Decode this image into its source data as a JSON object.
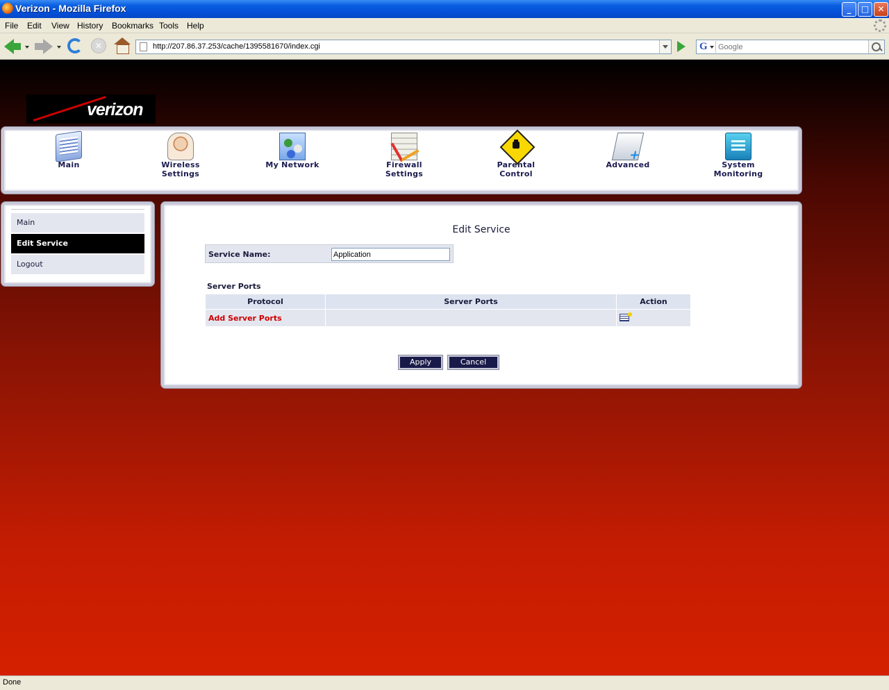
{
  "window": {
    "title": "Verizon - Mozilla Firefox"
  },
  "menu": [
    "File",
    "Edit",
    "View",
    "History",
    "Bookmarks",
    "Tools",
    "Help"
  ],
  "browser": {
    "url": "http://207.86.37.253/cache/1395581670/index.cgi",
    "search_placeholder": "Google",
    "search_engine_icon": "G"
  },
  "logo": {
    "text": "verizon"
  },
  "topnav": [
    {
      "label": "Main",
      "icon": "main-icon"
    },
    {
      "label": "Wireless\nSettings",
      "icon": "wireless-icon"
    },
    {
      "label": "My Network",
      "icon": "network-icon"
    },
    {
      "label": "Firewall\nSettings",
      "icon": "firewall-icon"
    },
    {
      "label": "Parental\nControl",
      "icon": "parental-icon"
    },
    {
      "label": "Advanced",
      "icon": "advanced-icon"
    },
    {
      "label": "System\nMonitoring",
      "icon": "system-icon"
    }
  ],
  "sidenav": {
    "items": [
      "Main",
      "Edit Service",
      "Logout"
    ],
    "active": "Edit Service"
  },
  "page": {
    "title": "Edit Service",
    "service_name_label": "Service Name:",
    "service_name_value": "Application",
    "server_ports_heading": "Server Ports",
    "table_headers": [
      "Protocol",
      "Server Ports",
      "Action"
    ],
    "add_link": "Add Server Ports",
    "apply_label": "Apply",
    "cancel_label": "Cancel"
  },
  "status": {
    "text": "Done"
  },
  "colors": {
    "accent_red": "#cc0000",
    "nav_text": "#1a1a50",
    "button_bg": "#1a1a4a"
  }
}
